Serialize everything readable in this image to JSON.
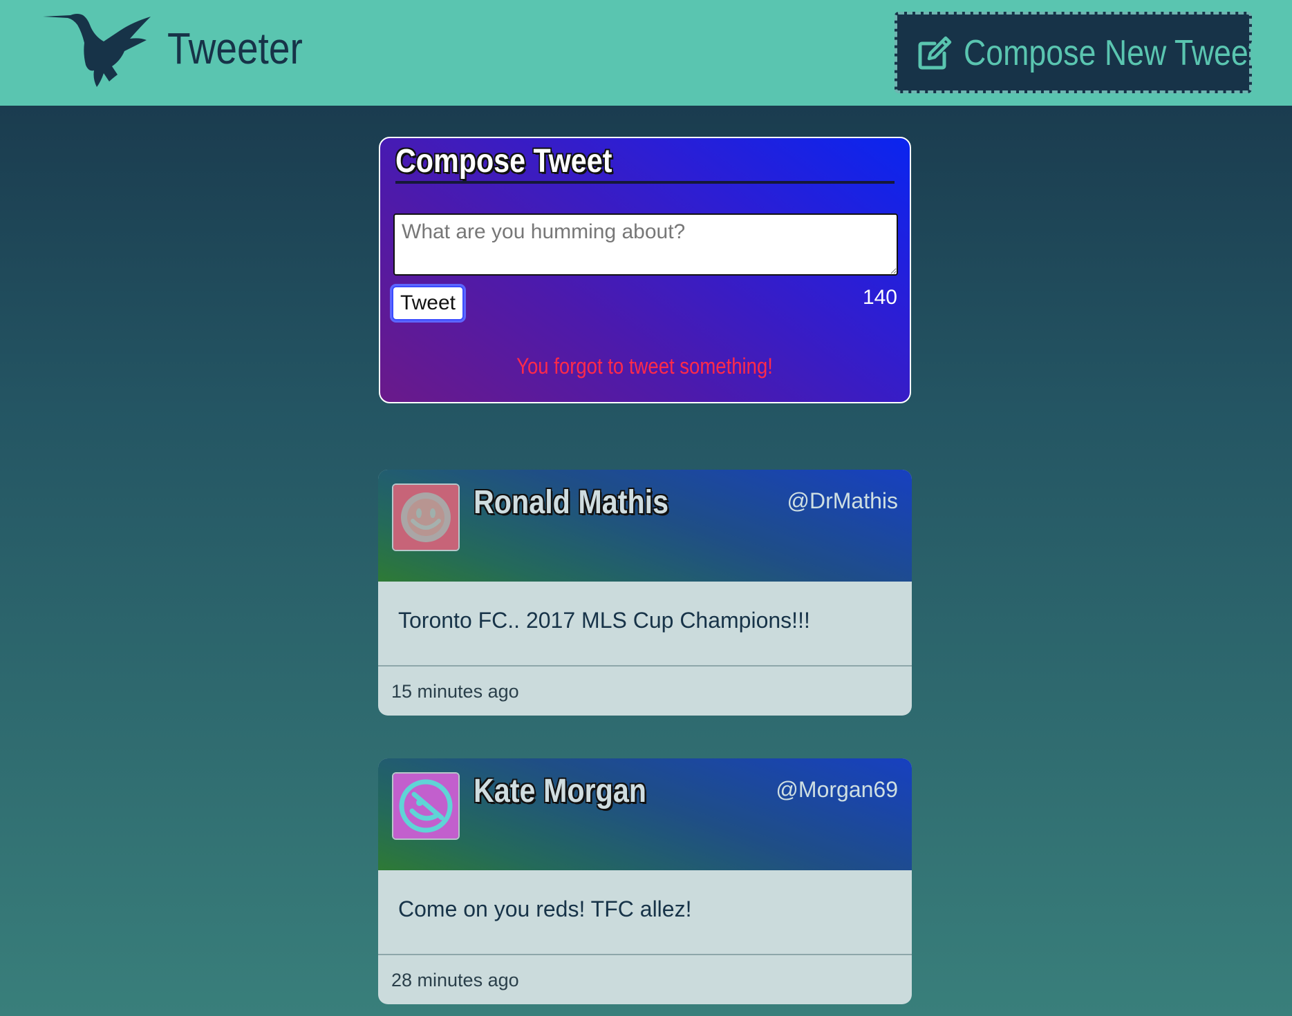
{
  "nav": {
    "brand": "Tweeter",
    "compose_label": "Compose New Tweet",
    "logo_icon": "hummingbird-icon",
    "compose_icon": "edit-icon"
  },
  "compose": {
    "title": "Compose Tweet",
    "placeholder": "What are you humming about?",
    "button_label": "Tweet",
    "counter": "140",
    "error": "You forgot to tweet something!"
  },
  "tweets": [
    {
      "name": "Ronald Mathis",
      "handle": "@DrMathis",
      "content": "Toronto FC.. 2017 MLS Cup Champions!!!",
      "time": "15 minutes ago",
      "avatar_icon": "smiley-avatar-icon",
      "avatar_color": "#c76478"
    },
    {
      "name": "Kate Morgan",
      "handle": "@Morgan69",
      "content": "Come on you reds! TFC allez!",
      "time": "28 minutes ago",
      "avatar_icon": "eyepatch-smiley-avatar-icon",
      "avatar_color": "#c25fcd"
    }
  ],
  "colors": {
    "nav_bg": "#5ac5b0",
    "dark_navy": "#173348",
    "error_red": "#ff2a4a",
    "card_body": "#cbdbdc"
  }
}
